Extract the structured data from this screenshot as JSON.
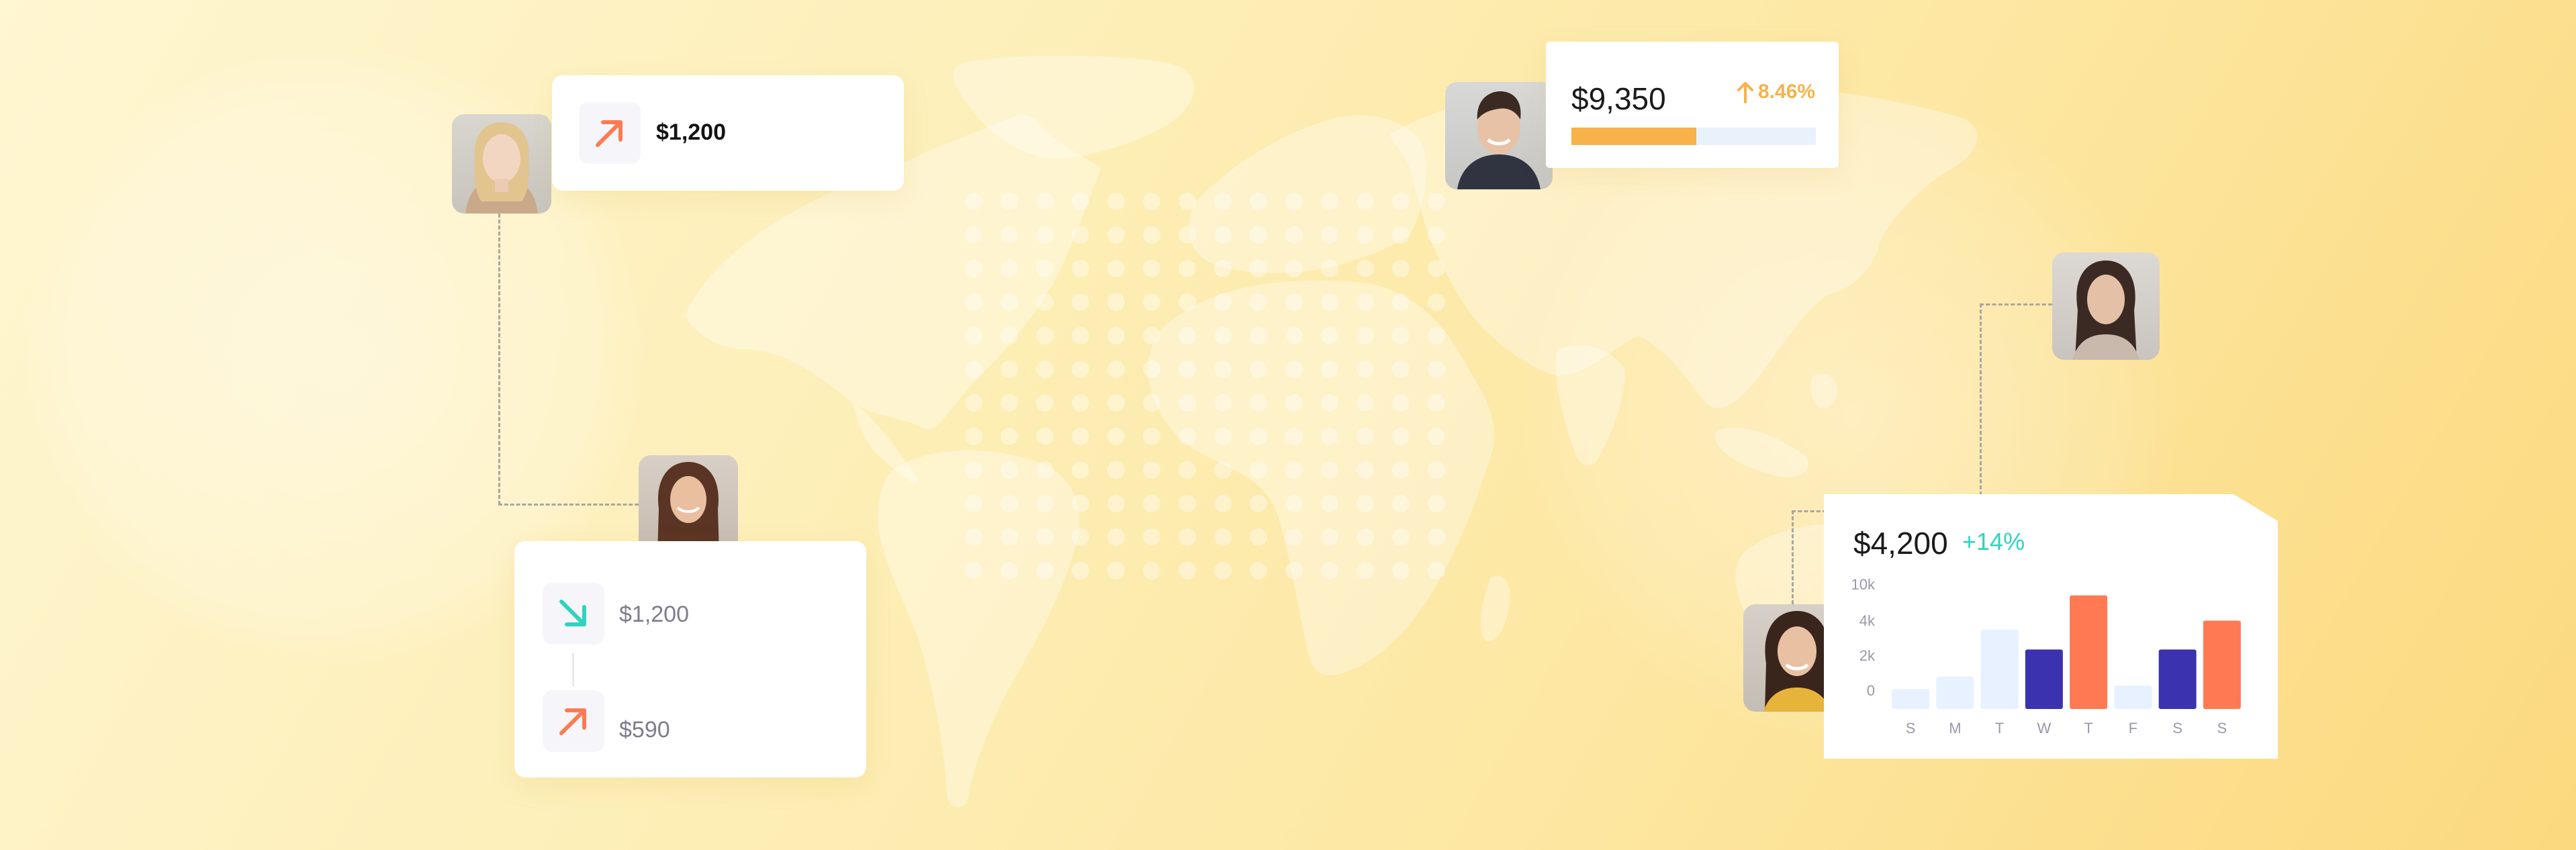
{
  "colors": {
    "accent_orange": "#ff7a52",
    "accent_yellow": "#f7b24a",
    "accent_teal": "#2fd3bf",
    "accent_indigo": "#3b32b0",
    "bar_light": "#e8f1ff",
    "muted_text": "#8e8c9a"
  },
  "card_top_left": {
    "icon": "arrow-up-right-icon",
    "amount": "$1,200"
  },
  "card_bottom_left": {
    "rows": [
      {
        "icon": "arrow-down-right-icon",
        "amount": "$1,200"
      },
      {
        "icon": "arrow-up-right-icon",
        "amount": "$590"
      }
    ]
  },
  "card_top_right": {
    "amount": "$9,350",
    "change": "8.46%",
    "change_icon": "arrow-up-icon",
    "progress": 0.51
  },
  "card_chart": {
    "amount": "$4,200",
    "change": "+14%"
  },
  "chart_data": {
    "type": "bar",
    "categories": [
      "S",
      "M",
      "T",
      "W",
      "T",
      "F",
      "S",
      "S"
    ],
    "values": [
      1100,
      1800,
      4400,
      3300,
      6300,
      1300,
      3300,
      4900
    ],
    "bar_colors": [
      "#e8f1ff",
      "#e8f1ff",
      "#e8f1ff",
      "#3b32b0",
      "#ff7a52",
      "#e8f1ff",
      "#3b32b0",
      "#ff7a52"
    ],
    "y_ticks": [
      "10k",
      "4k",
      "2k",
      "0"
    ],
    "title": "",
    "xlabel": "",
    "ylabel": "",
    "grid": false
  }
}
